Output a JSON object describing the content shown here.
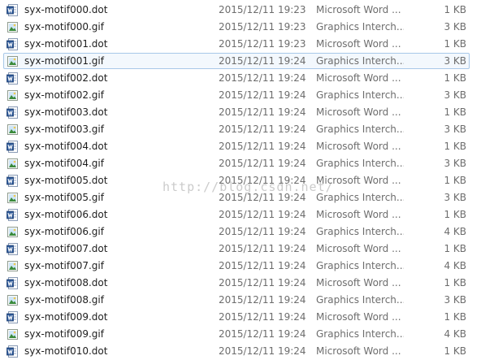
{
  "colors": {
    "name_text": "#1e1e1e",
    "meta_text": "#6d6d6d",
    "selection_border": "#a8c8e8",
    "selection_fill": "#f3f8fd",
    "word_icon_blue": "#2b5797",
    "gif_icon_green": "#3a8a3a"
  },
  "watermark": "http://blog.csdn.net/",
  "files": [
    {
      "name": "syx-motif000.dot",
      "date": "2015/12/11 19:23",
      "type": "Microsoft Word ...",
      "size": "1 KB",
      "icon": "word-document-icon"
    },
    {
      "name": "syx-motif000.gif",
      "date": "2015/12/11 19:23",
      "type": "Graphics Interch...",
      "size": "3 KB",
      "icon": "gif-image-icon"
    },
    {
      "name": "syx-motif001.dot",
      "date": "2015/12/11 19:23",
      "type": "Microsoft Word ...",
      "size": "1 KB",
      "icon": "word-document-icon"
    },
    {
      "name": "syx-motif001.gif",
      "date": "2015/12/11 19:24",
      "type": "Graphics Interch...",
      "size": "3 KB",
      "icon": "gif-image-icon",
      "selected": true
    },
    {
      "name": "syx-motif002.dot",
      "date": "2015/12/11 19:24",
      "type": "Microsoft Word ...",
      "size": "1 KB",
      "icon": "word-document-icon"
    },
    {
      "name": "syx-motif002.gif",
      "date": "2015/12/11 19:24",
      "type": "Graphics Interch...",
      "size": "3 KB",
      "icon": "gif-image-icon"
    },
    {
      "name": "syx-motif003.dot",
      "date": "2015/12/11 19:24",
      "type": "Microsoft Word ...",
      "size": "1 KB",
      "icon": "word-document-icon"
    },
    {
      "name": "syx-motif003.gif",
      "date": "2015/12/11 19:24",
      "type": "Graphics Interch...",
      "size": "3 KB",
      "icon": "gif-image-icon"
    },
    {
      "name": "syx-motif004.dot",
      "date": "2015/12/11 19:24",
      "type": "Microsoft Word ...",
      "size": "1 KB",
      "icon": "word-document-icon"
    },
    {
      "name": "syx-motif004.gif",
      "date": "2015/12/11 19:24",
      "type": "Graphics Interch...",
      "size": "3 KB",
      "icon": "gif-image-icon"
    },
    {
      "name": "syx-motif005.dot",
      "date": "2015/12/11 19:24",
      "type": "Microsoft Word ...",
      "size": "1 KB",
      "icon": "word-document-icon"
    },
    {
      "name": "syx-motif005.gif",
      "date": "2015/12/11 19:24",
      "type": "Graphics Interch...",
      "size": "3 KB",
      "icon": "gif-image-icon"
    },
    {
      "name": "syx-motif006.dot",
      "date": "2015/12/11 19:24",
      "type": "Microsoft Word ...",
      "size": "1 KB",
      "icon": "word-document-icon"
    },
    {
      "name": "syx-motif006.gif",
      "date": "2015/12/11 19:24",
      "type": "Graphics Interch...",
      "size": "4 KB",
      "icon": "gif-image-icon"
    },
    {
      "name": "syx-motif007.dot",
      "date": "2015/12/11 19:24",
      "type": "Microsoft Word ...",
      "size": "1 KB",
      "icon": "word-document-icon"
    },
    {
      "name": "syx-motif007.gif",
      "date": "2015/12/11 19:24",
      "type": "Graphics Interch...",
      "size": "4 KB",
      "icon": "gif-image-icon"
    },
    {
      "name": "syx-motif008.dot",
      "date": "2015/12/11 19:24",
      "type": "Microsoft Word ...",
      "size": "1 KB",
      "icon": "word-document-icon"
    },
    {
      "name": "syx-motif008.gif",
      "date": "2015/12/11 19:24",
      "type": "Graphics Interch...",
      "size": "3 KB",
      "icon": "gif-image-icon"
    },
    {
      "name": "syx-motif009.dot",
      "date": "2015/12/11 19:24",
      "type": "Microsoft Word ...",
      "size": "1 KB",
      "icon": "word-document-icon"
    },
    {
      "name": "syx-motif009.gif",
      "date": "2015/12/11 19:24",
      "type": "Graphics Interch...",
      "size": "4 KB",
      "icon": "gif-image-icon"
    },
    {
      "name": "syx-motif010.dot",
      "date": "2015/12/11 19:24",
      "type": "Microsoft Word ...",
      "size": "1 KB",
      "icon": "word-document-icon"
    }
  ]
}
